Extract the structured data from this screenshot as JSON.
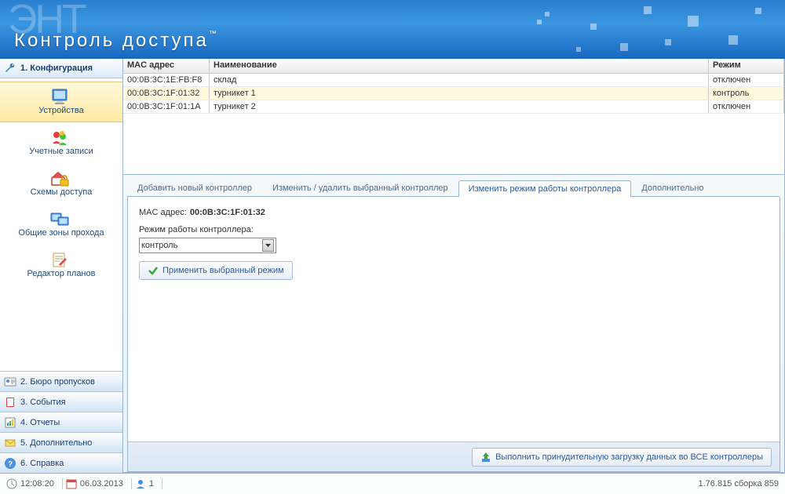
{
  "app_title": "Контроль доступа",
  "app_watermark": "ЭНТ",
  "sidebar": {
    "active_section": "1. Конфигурация",
    "items": [
      {
        "label": "Устройства",
        "icon": "monitor",
        "selected": true
      },
      {
        "label": "Учетные записи",
        "icon": "users",
        "selected": false
      },
      {
        "label": "Схемы доступа",
        "icon": "house-lock",
        "selected": false
      },
      {
        "label": "Общие зоны прохода",
        "icon": "monitors",
        "selected": false
      },
      {
        "label": "Редактор планов",
        "icon": "doc-edit",
        "selected": false
      }
    ],
    "bottom": [
      {
        "label": "2. Бюро пропусков",
        "icon": "badge"
      },
      {
        "label": "3. События",
        "icon": "book"
      },
      {
        "label": "4. Отчеты",
        "icon": "chart"
      },
      {
        "label": "5. Дополнительно",
        "icon": "mail"
      },
      {
        "label": "6. Справка",
        "icon": "help"
      }
    ]
  },
  "grid": {
    "columns": {
      "mac": "MAC адрес",
      "name": "Наименование",
      "mode": "Режим"
    },
    "rows": [
      {
        "mac": "00:0B:3C:1E:FB:F8",
        "name": "склад",
        "mode": "отключен",
        "selected": false
      },
      {
        "mac": "00:0B:3C:1F:01:32",
        "name": "турникет 1",
        "mode": "контроль",
        "selected": true
      },
      {
        "mac": "00:0B:3C:1F:01:1A",
        "name": "турникет 2",
        "mode": "отключен",
        "selected": false
      }
    ]
  },
  "tabs": [
    {
      "label": "Добавить новый контроллер",
      "active": false
    },
    {
      "label": "Изменить / удалить выбранный контроллер",
      "active": false
    },
    {
      "label": "Изменить режим работы контроллера",
      "active": true
    },
    {
      "label": "Дополнительно",
      "active": false
    }
  ],
  "form": {
    "mac_label": "MAC адрес:",
    "mac_value": "00:0B:3C:1F:01:32",
    "mode_label": "Режим работы контроллера:",
    "mode_value": "контроль",
    "apply_label": "Применить выбранный режим"
  },
  "bottom_button": "Выполнить принудительную загрузку данных во ВСЕ контроллеры",
  "status": {
    "time": "12:08:20",
    "date": "06.03.2013",
    "users": "1",
    "version": "1.76.815 сборка 859"
  }
}
